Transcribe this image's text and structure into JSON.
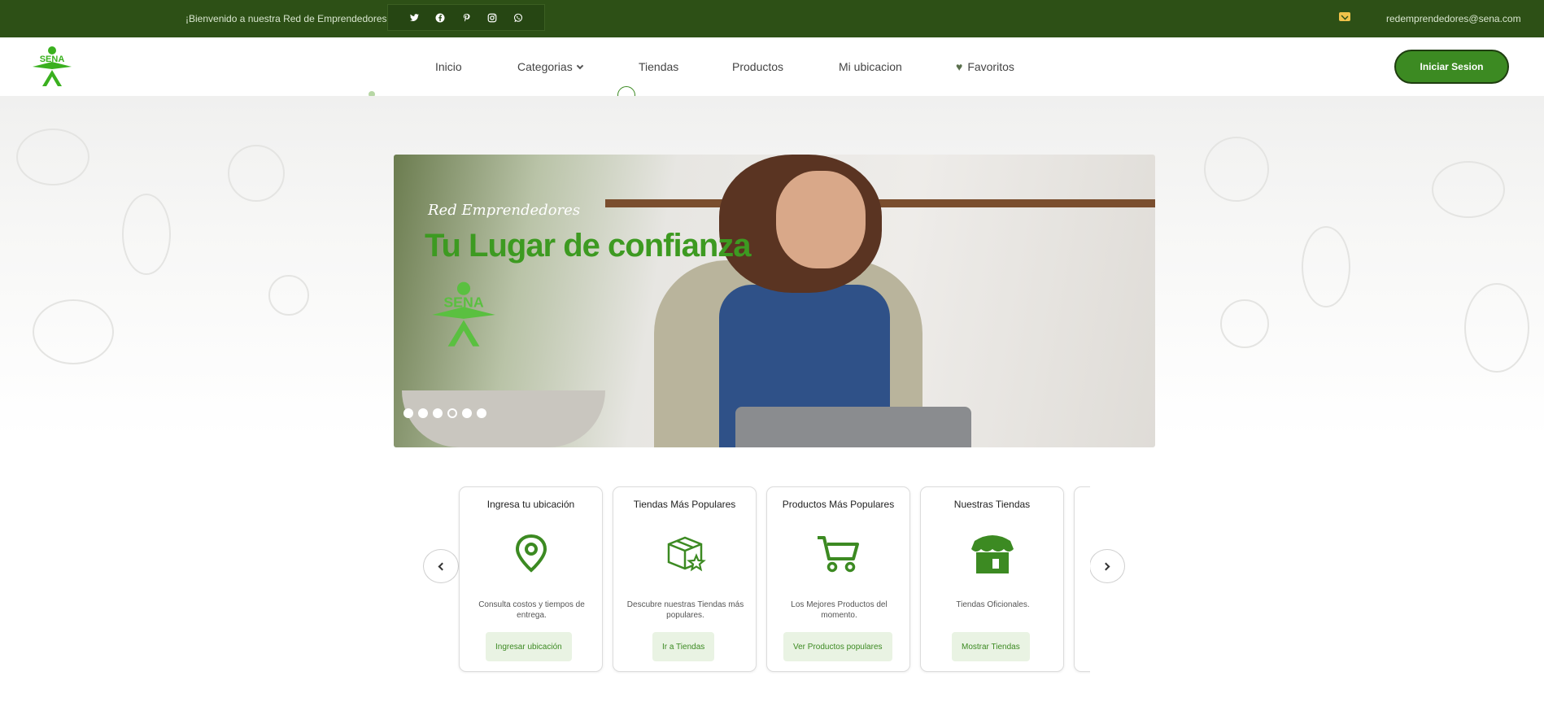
{
  "topbar": {
    "welcome": "¡Bienvenido a nuestra Red de Emprendedores!",
    "socials": [
      {
        "icon": "twitter-icon",
        "glyph": "𝕏"
      },
      {
        "icon": "facebook-icon",
        "glyph": "f"
      },
      {
        "icon": "pinterest-icon",
        "glyph": "P"
      },
      {
        "icon": "instagram-icon",
        "glyph": "◎"
      },
      {
        "icon": "whatsapp-icon",
        "glyph": "✆"
      }
    ],
    "email": "redemprendedores@sena.com"
  },
  "nav": {
    "logo_text": "SENA",
    "items": [
      "Inicio",
      "Categorias",
      "Tiendas",
      "Productos",
      "Mi ubicacion",
      "Favoritos"
    ],
    "login": "Iniciar Sesion"
  },
  "hero": {
    "brand": "Red Emprendedores",
    "headline": "Tu Lugar de confianza",
    "logo_text": "SENA",
    "slides": 6
  },
  "cards": [
    {
      "title": "Ingresa tu ubicación",
      "icon": "location-pin-icon",
      "desc": "Consulta costos y tiempos de entrega.",
      "button": "Ingresar ubicación"
    },
    {
      "title": "Tiendas Más Populares",
      "icon": "box-star-icon",
      "desc": "Descubre nuestras Tiendas más populares.",
      "button": "Ir a Tiendas"
    },
    {
      "title": "Productos Más Populares",
      "icon": "shopping-cart-icon",
      "desc": "Los Mejores Productos del momento.",
      "button": "Ver Productos populares"
    },
    {
      "title": "Nuestras Tiendas",
      "icon": "storefront-icon",
      "desc": "Tiendas Oficionales.",
      "button": "Mostrar Tiendas"
    }
  ],
  "colors": {
    "topbar": "#2d5016",
    "accent": "#3c8a22",
    "button_bg": "#e9f3e3"
  }
}
